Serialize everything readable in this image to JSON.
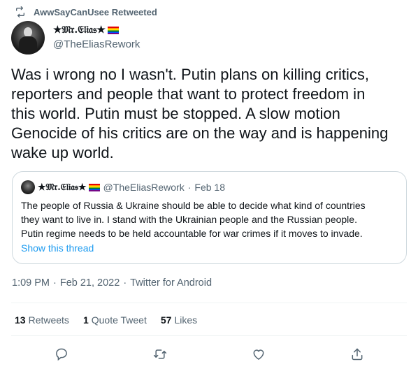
{
  "retweet_context": {
    "label": "AwwSayCanUsee Retweeted",
    "icon": "retweet-icon"
  },
  "author": {
    "display_name": "★𝔐𝔯.𝔈𝔩𝔦𝔞𝔰★",
    "handle": "@TheEliasRework",
    "badge_icon": "rainbow-flag-icon"
  },
  "tweet": {
    "text": "Was i wrong no I wasn't. Putin plans on killing critics,\nreporters and people that want to protect freedom in\nthis world. Putin must be stopped. A slow motion\nGenocide of his critics are on the way and is happening\nwake up world."
  },
  "quote": {
    "display_name": "★𝔐𝔯.𝔈𝔩𝔦𝔞𝔰★",
    "handle": "@TheEliasRework",
    "separator": "·",
    "date": "Feb 18",
    "text_lines": [
      "The people of Russia & Ukraine should be able to decide what kind of countries",
      "they want to live in. I stand with the Ukrainian people and the Russian people.",
      "Putin regime needs to be held accountable for war crimes if it moves to invade."
    ],
    "show_thread_label": "Show this thread"
  },
  "meta": {
    "time": "1:09 PM",
    "sep1": "·",
    "date": "Feb 21, 2022",
    "sep2": "·",
    "source": "Twitter for Android"
  },
  "stats": {
    "retweets": {
      "count": "13",
      "label": "Retweets"
    },
    "quotes": {
      "count": "1",
      "label": "Quote Tweet"
    },
    "likes": {
      "count": "57",
      "label": "Likes"
    }
  },
  "actions": [
    "reply-icon",
    "retweet-icon",
    "like-icon",
    "share-icon"
  ],
  "colors": {
    "accent": "#1d9bf0",
    "secondary_text": "#536471",
    "primary_text": "#0f1419",
    "border": "#cfd9de"
  }
}
